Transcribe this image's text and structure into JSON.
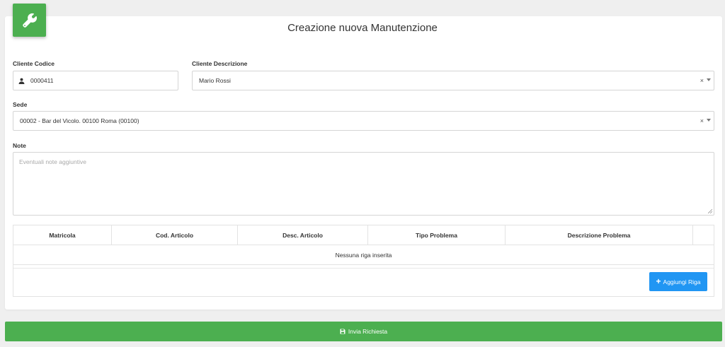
{
  "title": "Creazione nuova Manutenzione",
  "header_icon": "wrench-icon",
  "form": {
    "cliente_codice": {
      "label": "Cliente Codice",
      "value": "0000411",
      "icon": "user-icon"
    },
    "cliente_descrizione": {
      "label": "Cliente Descrizione",
      "value": "Mario Rossi",
      "clear": "×"
    },
    "sede": {
      "label": "Sede",
      "value": "00002 - Bar del Vicolo. 00100 Roma (00100)",
      "clear": "×"
    },
    "note": {
      "label": "Note",
      "placeholder": "Eventuali note aggiuntive"
    }
  },
  "table": {
    "columns": [
      "Matricola",
      "Cod. Articolo",
      "Desc. Articolo",
      "Tipo Problema",
      "Descrizione Problema",
      ""
    ],
    "empty_message": "Nessuna riga inserita"
  },
  "add_row_button": {
    "icon": "plus-icon",
    "label": "Aggiungi Riga"
  },
  "submit_button": {
    "icon": "save-icon",
    "label": "Invia Richiesta"
  },
  "colors": {
    "green": "#4caf50",
    "blue": "#2196f3",
    "background": "#efefef"
  }
}
